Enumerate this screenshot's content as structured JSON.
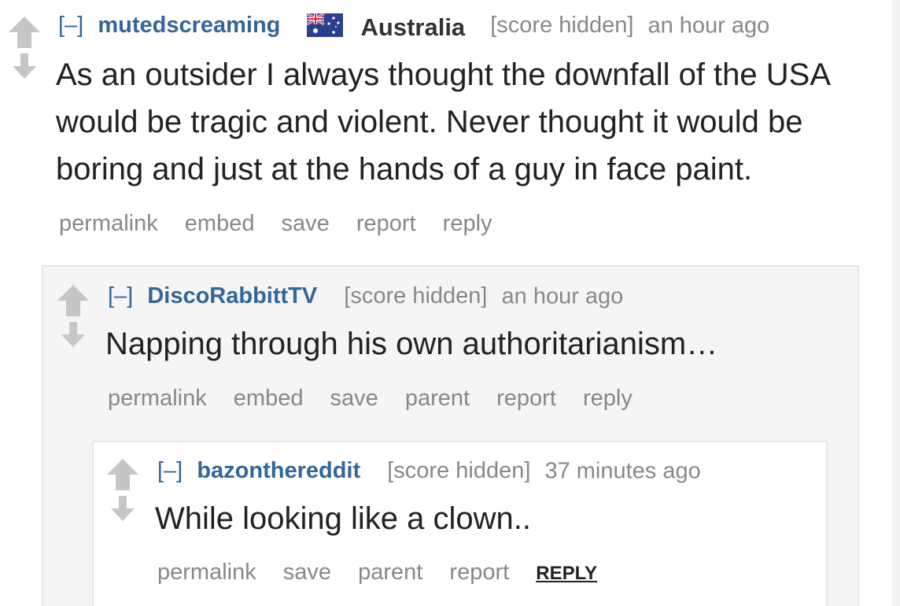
{
  "comments": [
    {
      "expand": "[–]",
      "author": "mutedscreaming",
      "flair": {
        "icon": "australia-flag-icon",
        "text": "Australia"
      },
      "score": "[score hidden]",
      "time": "an hour ago",
      "body": "As an outsider I always thought the downfall of the USA would be tragic and violent. Never thought it would be boring and just at the hands of a guy in face paint.",
      "buttons": [
        "permalink",
        "embed",
        "save",
        "report",
        "reply"
      ]
    },
    {
      "expand": "[–]",
      "author": "DiscoRabbittTV",
      "score": "[score hidden]",
      "time": "an hour ago",
      "body": "Napping through his own authoritarianism…",
      "buttons": [
        "permalink",
        "embed",
        "save",
        "parent",
        "report",
        "reply"
      ]
    },
    {
      "expand": "[–]",
      "author": "bazonthereddit",
      "score": "[score hidden]",
      "time": "37 minutes ago",
      "body": "While looking like a clown..",
      "buttons": [
        "permalink",
        "save",
        "parent",
        "report"
      ],
      "reply_label": "REPLY"
    }
  ],
  "colors": {
    "author": "#336699",
    "meta": "#888888",
    "body": "#222222",
    "vote_arrow": "#c6c6c6",
    "nested_bg_1": "#f5f5f5",
    "nested_bg_2": "#ffffff"
  },
  "icons": [
    "upvote-arrow-icon",
    "downvote-arrow-icon",
    "australia-flag-icon"
  ]
}
